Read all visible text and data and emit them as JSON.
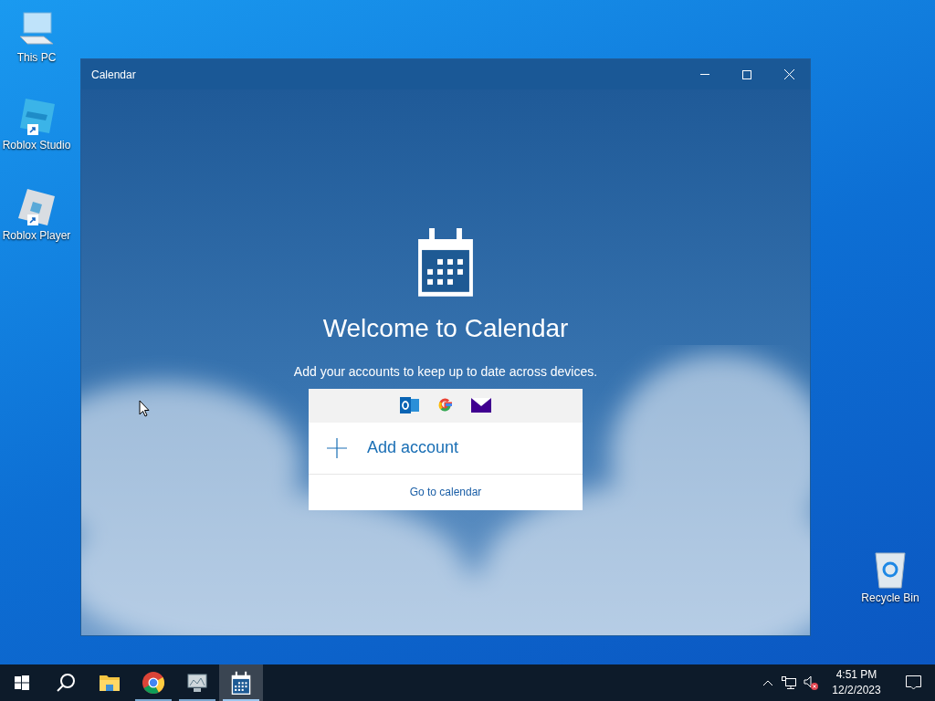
{
  "desktop_icons": [
    {
      "label": "This PC",
      "kind": "computer",
      "shortcut": false
    },
    {
      "label": "Roblox Studio",
      "kind": "studio",
      "shortcut": true
    },
    {
      "label": "Roblox Player",
      "kind": "player",
      "shortcut": true
    },
    {
      "label": "Recycle Bin",
      "kind": "recycle",
      "shortcut": false
    }
  ],
  "window": {
    "title": "Calendar",
    "heading": "Welcome to Calendar",
    "subtitle": "Add your accounts to keep up to date across devices.",
    "providers": [
      {
        "kind": "outlook"
      },
      {
        "kind": "google"
      },
      {
        "kind": "mail"
      }
    ],
    "add_account": "Add account",
    "go_to_calendar": "Go to calendar"
  },
  "taskbar": {
    "items": [
      {
        "kind": "start",
        "running": false,
        "selected": false
      },
      {
        "kind": "search",
        "running": false,
        "selected": false
      },
      {
        "kind": "explorer",
        "running": false,
        "selected": false
      },
      {
        "kind": "chrome",
        "running": true,
        "selected": false
      },
      {
        "kind": "app",
        "running": true,
        "selected": false
      },
      {
        "kind": "calendar",
        "running": true,
        "selected": true
      }
    ],
    "time": "4:51 PM",
    "date": "12/2/2023"
  }
}
